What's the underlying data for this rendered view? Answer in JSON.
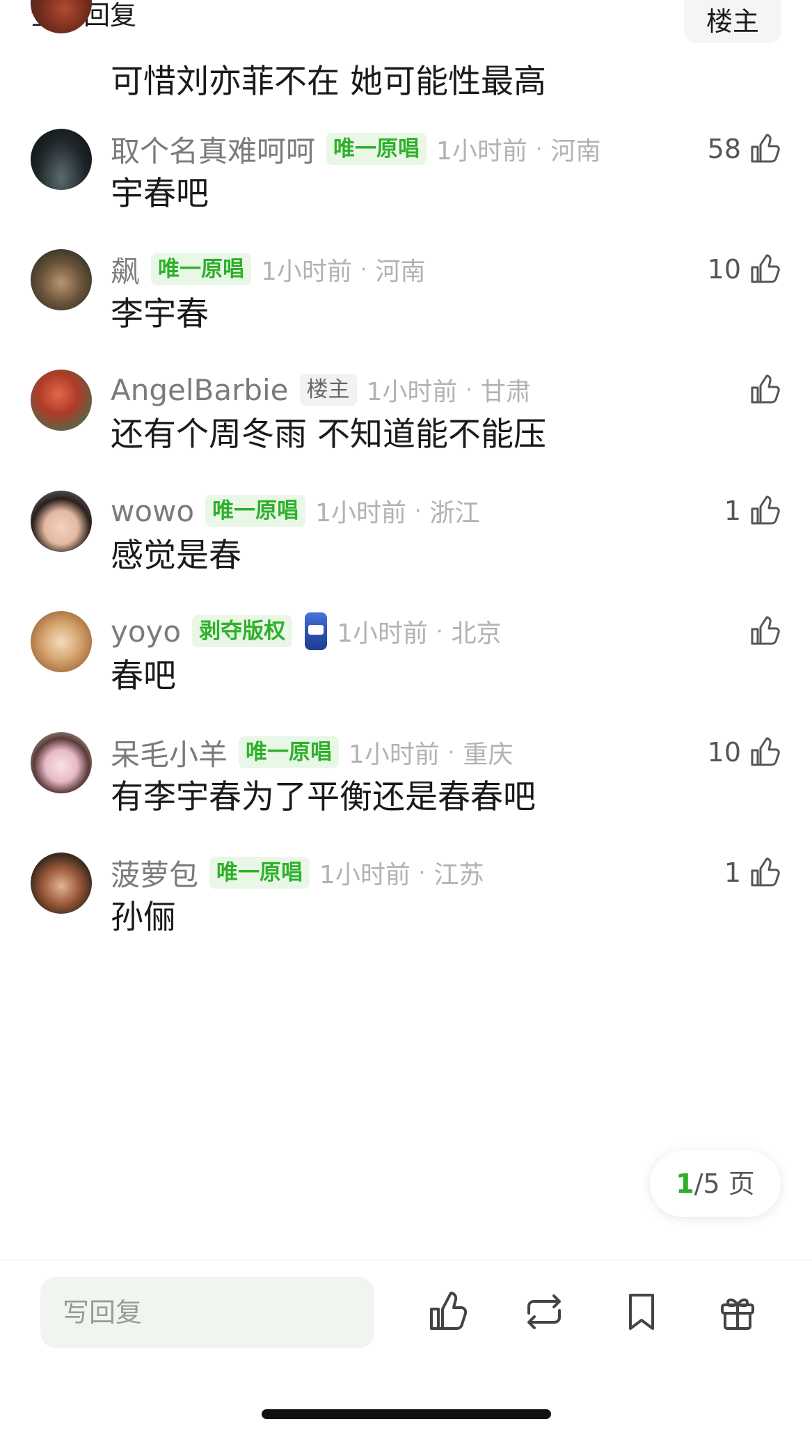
{
  "header": {
    "title": "全部回复",
    "owner_button": "楼主"
  },
  "top_comment": {
    "content": "可惜刘亦菲不在 她可能性最高"
  },
  "comments": [
    {
      "username": "取个名真难呵呵",
      "badge": "唯一原唱",
      "time": "1小时前",
      "region": "河南",
      "content": "宇春吧",
      "likes": "58"
    },
    {
      "username": "飙",
      "badge": "唯一原唱",
      "time": "1小时前",
      "region": "河南",
      "content": "李宇春",
      "likes": "10"
    },
    {
      "username": "AngelBarbie",
      "badge": "楼主",
      "time": "1小时前",
      "region": "甘肃",
      "content": "还有个周冬雨 不知道能不能压",
      "likes": ""
    },
    {
      "username": "wowo",
      "badge": "唯一原唱",
      "time": "1小时前",
      "region": "浙江",
      "content": "感觉是春",
      "likes": "1"
    },
    {
      "username": "yoyo",
      "badge": "剥夺版权",
      "time": "1小时前",
      "region": "北京",
      "content": "春吧",
      "likes": ""
    },
    {
      "username": "呆毛小羊",
      "badge": "唯一原唱",
      "time": "1小时前",
      "region": "重庆",
      "content": "有李宇春为了平衡还是春春吧",
      "likes": "10"
    },
    {
      "username": "菠萝包",
      "badge": "唯一原唱",
      "time": "1小时前",
      "region": "江苏",
      "content": "孙俪",
      "likes": "1"
    }
  ],
  "pager": {
    "current": "1",
    "total_text": "/5 页"
  },
  "bottom_bar": {
    "reply_placeholder": "写回复"
  },
  "icons": {
    "thumb": "thumbs-up-icon",
    "repost": "repost-icon",
    "bookmark": "bookmark-icon",
    "gift": "gift-icon"
  },
  "colors": {
    "accent_green": "#2fb02a",
    "badge_bg": "#e9f7e7",
    "meta_gray": "#b2b2b2",
    "username_gray": "#7b7b7b"
  }
}
